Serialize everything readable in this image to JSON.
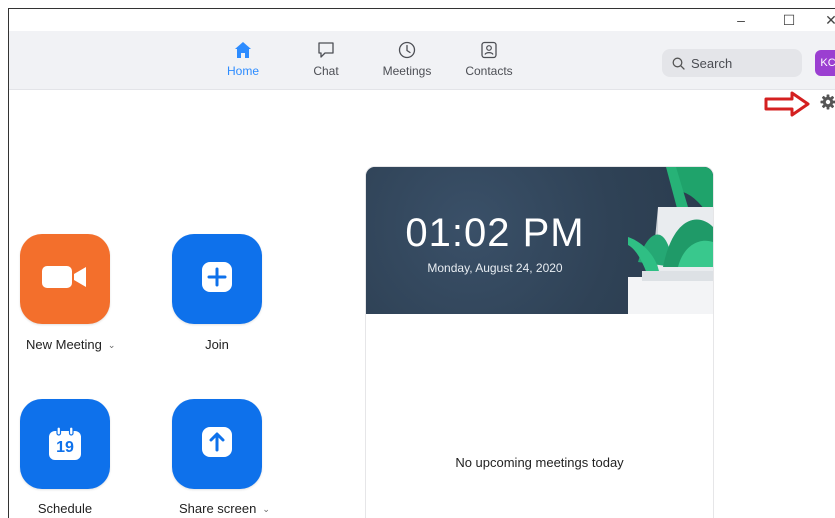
{
  "window_controls": {
    "minimize": "–",
    "maximize": "☐",
    "close": "✕"
  },
  "nav": [
    {
      "label": "Home",
      "icon": "home-icon",
      "active": true
    },
    {
      "label": "Chat",
      "icon": "chat-icon",
      "active": false
    },
    {
      "label": "Meetings",
      "icon": "clock-icon",
      "active": false
    },
    {
      "label": "Contacts",
      "icon": "contacts-icon",
      "active": false
    }
  ],
  "search": {
    "placeholder": "Search"
  },
  "avatar": {
    "initials": "KC"
  },
  "actions": [
    {
      "label": "New Meeting",
      "icon": "video-camera-icon",
      "color": "#f36f2c",
      "has_dropdown": true
    },
    {
      "label": "Join",
      "icon": "plus-icon",
      "color": "#0e71eb",
      "has_dropdown": false
    },
    {
      "label": "Schedule",
      "icon": "calendar-icon",
      "color": "#0e71eb",
      "has_dropdown": false,
      "icon_text": "19"
    },
    {
      "label": "Share screen",
      "icon": "share-arrow-icon",
      "color": "#0e71eb",
      "has_dropdown": true
    }
  ],
  "dropdown_glyph": "⌄",
  "clock": {
    "time": "01:02 PM",
    "date": "Monday, August 24, 2020"
  },
  "meetings": {
    "empty_text": "No upcoming meetings today"
  },
  "annotation": {
    "arrow_color": "#d42020",
    "points_to": "gear-icon"
  },
  "colors": {
    "accent": "#2d8cff",
    "orange": "#f36f2c",
    "blue": "#0e71eb",
    "banner": "#2f4256"
  }
}
